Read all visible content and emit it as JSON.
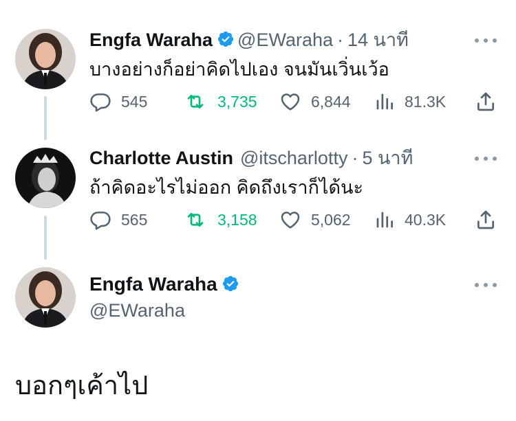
{
  "tweets": [
    {
      "name": "Engfa Waraha",
      "handle": "@EWaraha",
      "separator": "·",
      "time": "14 นาที",
      "text": "บางอย่างก็อย่าคิดไปเอง จนมันเวิ่นเว้อ",
      "replies": "545",
      "retweets": "3,735",
      "likes": "6,844",
      "views": "81.3K"
    },
    {
      "name": "Charlotte Austin",
      "handle": "@itscharlotty",
      "separator": "·",
      "time": "5 นาที",
      "text": "ถ้าคิดอะไรไม่ออก คิดถึงเราก็ได้นะ",
      "replies": "565",
      "retweets": "3,158",
      "likes": "5,062",
      "views": "40.3K"
    }
  ],
  "reply_author": {
    "name": "Engfa Waraha",
    "handle": "@EWaraha"
  },
  "reply_text": "บอกๆเค้าไป",
  "colors": {
    "verified": "#1d9bf0",
    "retweet": "#00ba7c",
    "muted": "#536471",
    "thread_line": "#cfd9de"
  },
  "icons": [
    "reply-icon",
    "retweet-icon",
    "like-icon",
    "views-icon",
    "share-icon",
    "verified-badge-icon",
    "more-icon"
  ]
}
